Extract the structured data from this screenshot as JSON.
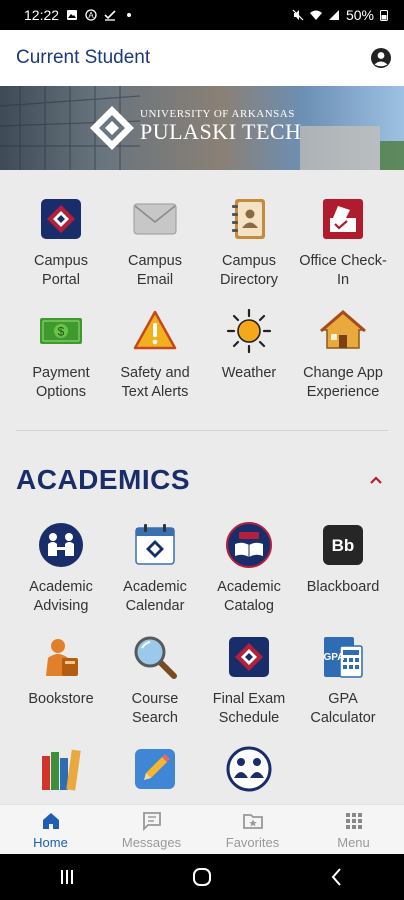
{
  "status_bar": {
    "time": "12:22",
    "battery": "50%"
  },
  "header": {
    "title": "Current Student"
  },
  "banner": {
    "subtitle": "UNIVERSITY OF ARKANSAS",
    "title": "PULASKI TECH"
  },
  "quick_tiles": [
    {
      "line1": "Campus",
      "line2": "Portal",
      "icon": "campus-portal-icon"
    },
    {
      "line1": "Campus",
      "line2": "Email",
      "icon": "envelope-icon"
    },
    {
      "line1": "Campus",
      "line2": "Directory",
      "icon": "address-book-icon"
    },
    {
      "line1": "Office Check-",
      "line2": "In",
      "icon": "check-in-icon"
    },
    {
      "line1": "Payment",
      "line2": "Options",
      "icon": "money-icon"
    },
    {
      "line1": "Safety and",
      "line2": "Text Alerts",
      "icon": "warning-icon"
    },
    {
      "line1": "Weather",
      "line2": "",
      "icon": "sun-icon"
    },
    {
      "line1": "Change App",
      "line2": "Experience",
      "icon": "house-icon"
    }
  ],
  "academics": {
    "title": "ACADEMICS",
    "tiles": [
      {
        "line1": "Academic",
        "line2": "Advising",
        "icon": "advising-icon"
      },
      {
        "line1": "Academic",
        "line2": "Calendar",
        "icon": "calendar-icon"
      },
      {
        "line1": "Academic",
        "line2": "Catalog",
        "icon": "catalog-icon"
      },
      {
        "line1": "Blackboard",
        "line2": "",
        "icon": "blackboard-icon",
        "badge": "Bb"
      },
      {
        "line1": "Bookstore",
        "line2": "",
        "icon": "bookstore-icon"
      },
      {
        "line1": "Course",
        "line2": "Search",
        "icon": "magnifier-icon"
      },
      {
        "line1": "Final Exam",
        "line2": "Schedule",
        "icon": "exam-schedule-icon"
      },
      {
        "line1": "GPA",
        "line2": "Calculator",
        "icon": "gpa-calculator-icon",
        "badge": "GPA"
      },
      {
        "line1": "",
        "line2": "",
        "icon": "books-icon"
      },
      {
        "line1": "",
        "line2": "",
        "icon": "pencil-icon"
      },
      {
        "line1": "",
        "line2": "",
        "icon": "tutoring-icon"
      }
    ]
  },
  "bottom_nav": [
    {
      "label": "Home",
      "active": true
    },
    {
      "label": "Messages",
      "active": false
    },
    {
      "label": "Favorites",
      "active": false
    },
    {
      "label": "Menu",
      "active": false
    }
  ],
  "colors": {
    "brand_navy": "#1a2d6b",
    "header_blue": "#1a3a78",
    "active_blue": "#1e5fb3",
    "logo_red": "#9b1b30"
  }
}
